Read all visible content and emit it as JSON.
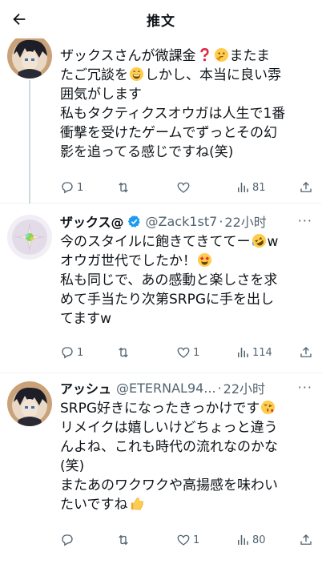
{
  "header": {
    "title": "推文"
  },
  "icons": {
    "back": "arrow-left-icon",
    "reply": "reply-icon",
    "retweet": "retweet-icon",
    "like": "heart-icon",
    "views": "views-icon",
    "share": "share-icon",
    "verified": "verified-badge-icon"
  },
  "colors": {
    "text": "#0f1419",
    "secondary": "#536471",
    "verified": "#1d9bf0",
    "divider": "#eff3f4"
  },
  "tweets": [
    {
      "lines": [
        "ザックスさんが微課金",
        "たご冗談を",
        "囲気がします",
        "私もタクティクスオウガは人生で1番",
        "衝撃を受けたゲームでずっとその幻",
        "影を追ってる感じですね(笑)"
      ],
      "line1_tail": "またま",
      "line2_tail": "しかし、本当に良い雰",
      "replies": "1",
      "likes": "",
      "views": "81"
    },
    {
      "name": "ザックス@",
      "handle": "@Zack1st7",
      "sep": "·",
      "time": "22小时",
      "more": "···",
      "lines": [
        "今のスタイルに飽きてきててー",
        "オウガ世代でしたか！",
        "私も同じで、あの感動と楽しさを求",
        "めて手当たり次第SRPGに手を出し",
        "てますw"
      ],
      "line1_tail": "w",
      "replies": "1",
      "likes": "1",
      "views": "114"
    },
    {
      "name": "アッシュ",
      "handle": "@ETERNAL94...",
      "sep": "·",
      "time": "22小时",
      "more": "···",
      "lines": [
        "SRPG好きになったきっかけです",
        "リメイクは嬉しいけどちょっと違う",
        "んよね、これも時代の流れなのかな",
        "(笑)",
        "またあのワクワクや高揚感を味わい",
        "たいですね"
      ],
      "replies": "",
      "likes": "1",
      "views": "80"
    }
  ]
}
